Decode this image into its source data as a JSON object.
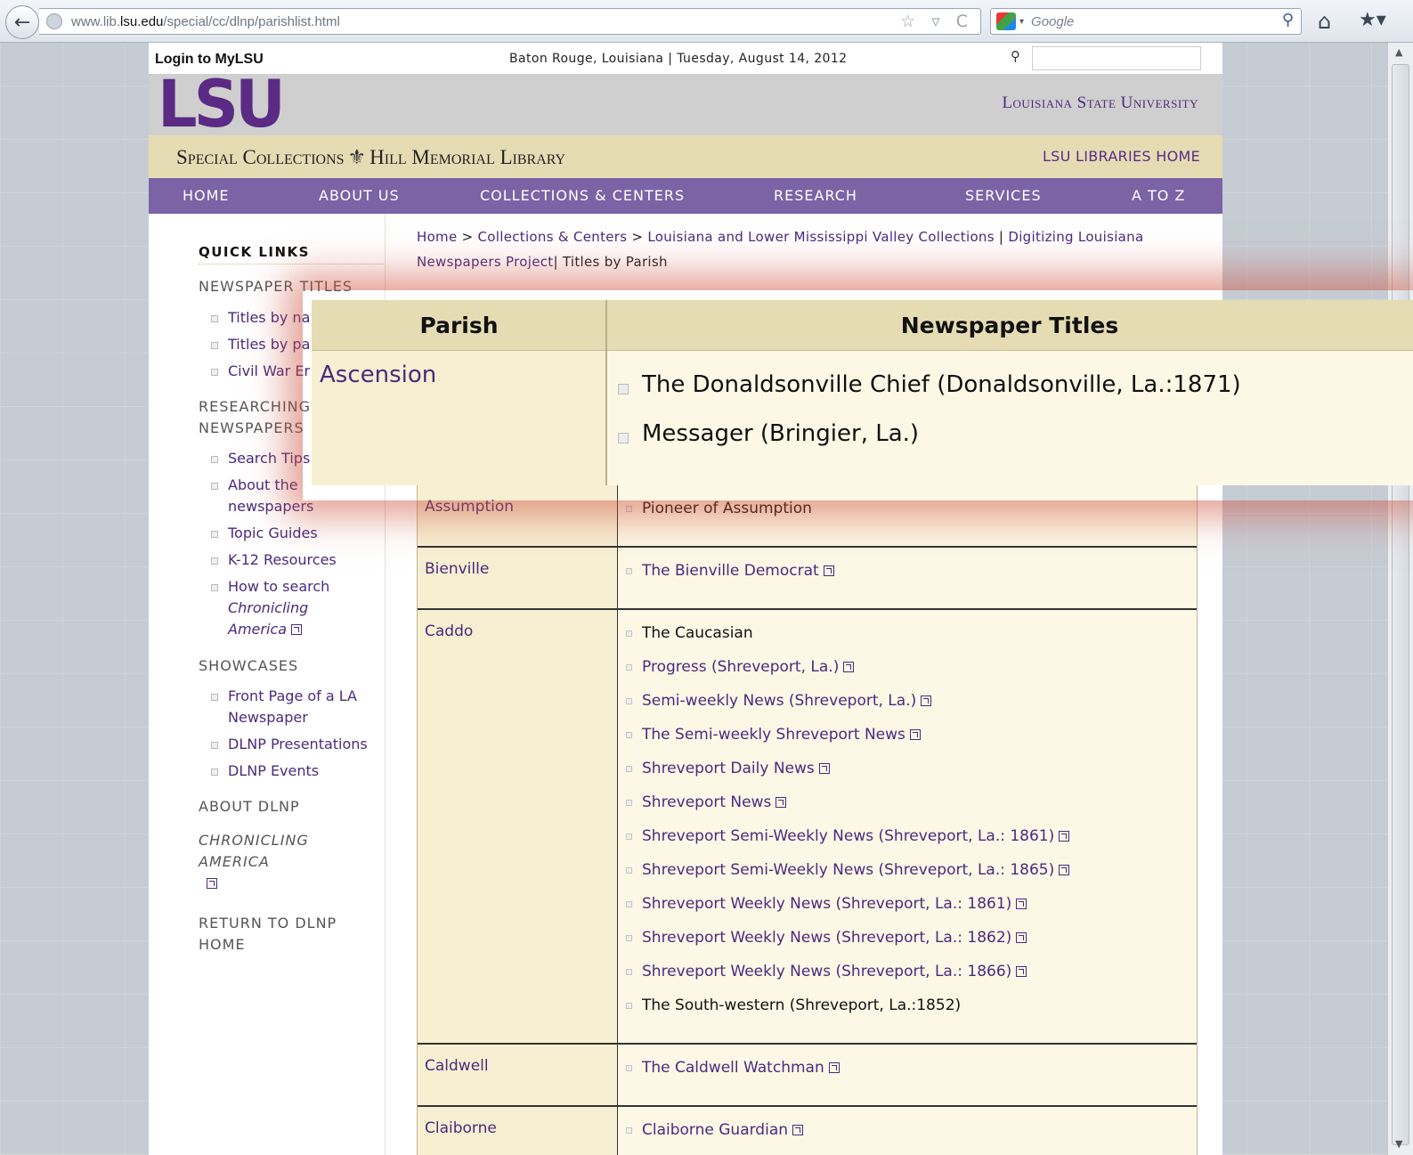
{
  "browser": {
    "url_prefix": "www.lib.",
    "url_domain": "lsu.edu",
    "url_path": "/special/cc/dlnp/parishlist.html",
    "url_icons": "☆ ▿ C",
    "search_placeholder": "Google",
    "back_glyph": "←",
    "home_glyph": "⌂",
    "bookmark_glyph": "★▾",
    "search_go_glyph": "⚲"
  },
  "site": {
    "login": "Login to MyLSU",
    "dateline": "Baton Rouge, Louisiana | Tuesday, August 14, 2012",
    "logo": "LSU",
    "university": "Louisiana State University",
    "collection_left": "Special Collections",
    "fleur": "⚜",
    "collection_right": "Hill Memorial Library",
    "libraries_home": "LSU LIBRARIES HOME"
  },
  "nav": [
    {
      "label": "HOME"
    },
    {
      "label": "ABOUT US"
    },
    {
      "label": "COLLECTIONS & CENTERS"
    },
    {
      "label": "RESEARCH"
    },
    {
      "label": "SERVICES"
    },
    {
      "label": "A TO Z"
    }
  ],
  "sidebar": {
    "heading": "QUICK LINKS",
    "sections": {
      "newspaper_titles": "NEWSPAPER TITLES",
      "researching_1": "RESEARCHING",
      "researching_2": "NEWSPAPERS",
      "showcases": "SHOWCASES",
      "about": "ABOUT DLNP",
      "chronicling_1": "CHRONICLING",
      "chronicling_2": "AMERICA",
      "return_1": "RETURN TO DLNP",
      "return_2": "HOME"
    },
    "items": {
      "titles_by_name": "Titles by na",
      "titles_by_parish": "Titles by pa",
      "civil_war": "Civil War Er",
      "search_tips": "Search Tips",
      "about_1": "About the",
      "about_2": "newspapers",
      "topic_guides": "Topic Guides",
      "k12": "K-12 Resources",
      "how_1": "How to search",
      "how_2": "Chronicling",
      "how_3": "America",
      "front_1": "Front Page of a LA",
      "front_2": "Newspaper",
      "presentations": "DLNP Presentations",
      "events": "DLNP Events"
    }
  },
  "breadcrumb": {
    "home": "Home",
    "sep": " > ",
    "collections": "Collections & Centers",
    "llmvc": "Louisiana and Lower Mississippi Valley Collections",
    "pipe": " | ",
    "dlnp_1": "Digitizing Louisiana",
    "dlnp_2": "Newspapers Project",
    "current": "| Titles by Parish"
  },
  "table": {
    "header_parish": "Parish",
    "header_titles": "Newspaper Titles",
    "rows": [
      {
        "parish": "Assumption",
        "titles": [
          {
            "t": "Pioneer of Assumption",
            "link": false
          }
        ]
      },
      {
        "parish": "Bienville",
        "titles": [
          {
            "t": "The Bienville Democrat",
            "link": true
          }
        ]
      },
      {
        "parish": "Caddo",
        "titles": [
          {
            "t": "The Caucasian",
            "link": false
          },
          {
            "t": "Progress (Shreveport, La.)",
            "link": true
          },
          {
            "t": "Semi-weekly News (Shreveport, La.)",
            "link": true
          },
          {
            "t": "The Semi-weekly Shreveport News",
            "link": true
          },
          {
            "t": "Shreveport Daily News",
            "link": true
          },
          {
            "t": "Shreveport News",
            "link": true
          },
          {
            "t": "Shreveport Semi-Weekly News (Shreveport, La.: 1861)",
            "link": true
          },
          {
            "t": "Shreveport Semi-Weekly News (Shreveport, La.: 1865)",
            "link": true
          },
          {
            "t": "Shreveport Weekly News (Shreveport, La.: 1861)",
            "link": true
          },
          {
            "t": "Shreveport Weekly News (Shreveport, La.: 1862)",
            "link": true
          },
          {
            "t": "Shreveport Weekly News (Shreveport, La.: 1866)",
            "link": true
          },
          {
            "t": "The South-western (Shreveport, La.:1852)",
            "link": false
          }
        ]
      },
      {
        "parish": "Caldwell",
        "titles": [
          {
            "t": "The Caldwell Watchman",
            "link": true
          }
        ]
      },
      {
        "parish": "Claiborne",
        "titles": [
          {
            "t": "Claiborne Guardian",
            "link": true
          }
        ]
      }
    ]
  },
  "zoom": {
    "parish": "Ascension",
    "titles": [
      "The Donaldsonville Chief (Donaldsonville, La.:1871)",
      "Messager (Bringier, La.)"
    ]
  },
  "colors": {
    "lsu_purple": "#4b2a7c",
    "nav_purple": "#7b63a6",
    "gold_band": "#e6dcb4",
    "table_bg": "#f7efd2"
  }
}
